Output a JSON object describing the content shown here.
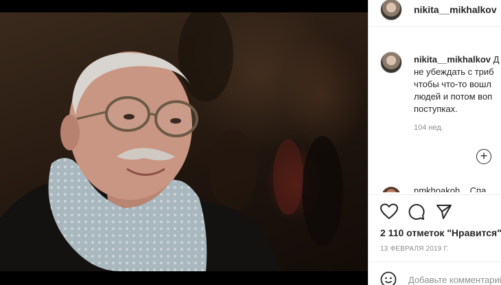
{
  "post": {
    "username": "nikita__mikhalkov",
    "caption_user": "nikita__mikhalkov",
    "caption_lines": [
      " Д",
      "не убеждать с триб",
      "чтобы что-то вошл",
      "людей и потом воп",
      "поступках."
    ],
    "time_ago": "104 нед.",
    "next_comment_preview": "nmkhoakoh... Спа",
    "likes": "2 110 отметок \"Нравится\"",
    "date": "13 ФЕВРАЛЯ 2019 Г.",
    "comment_placeholder": "Добавьте комментарий..."
  },
  "icons": {
    "like": "heart-icon",
    "comment": "comment-bubble-icon",
    "share": "paper-plane-icon",
    "add": "plus-circle-icon",
    "emoji": "smiley-icon"
  },
  "colors": {
    "text": "#262626",
    "muted": "#8e8e8e",
    "divider": "#efefef"
  }
}
